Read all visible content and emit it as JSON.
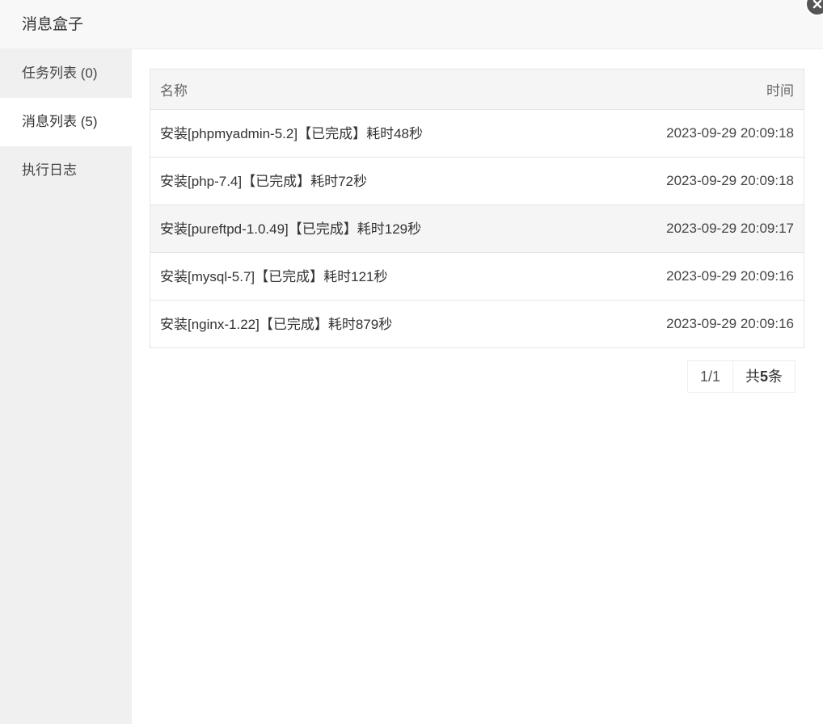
{
  "window": {
    "title": "消息盒子",
    "close_icon": "close-icon"
  },
  "sidebar": {
    "items": [
      {
        "label": "任务列表 (0)",
        "active": false
      },
      {
        "label": "消息列表 (5)",
        "active": true
      },
      {
        "label": "执行日志",
        "active": false
      }
    ]
  },
  "table": {
    "headers": {
      "name": "名称",
      "time": "时间"
    },
    "rows": [
      {
        "name": "安装[phpmyadmin-5.2]【已完成】耗时48秒",
        "time": "2023-09-29 20:09:18"
      },
      {
        "name": "安装[php-7.4]【已完成】耗时72秒",
        "time": "2023-09-29 20:09:18"
      },
      {
        "name": "安装[pureftpd-1.0.49]【已完成】耗时129秒",
        "time": "2023-09-29 20:09:17"
      },
      {
        "name": "安装[mysql-5.7]【已完成】耗时121秒",
        "time": "2023-09-29 20:09:16"
      },
      {
        "name": "安装[nginx-1.22]【已完成】耗时879秒",
        "time": "2023-09-29 20:09:16"
      }
    ]
  },
  "pager": {
    "page": "1/1",
    "total_prefix": "共",
    "total_count": "5",
    "total_suffix": "条"
  },
  "colors": {
    "sidebar_bg": "#f0f0f0",
    "header_bg": "#f8f8f8",
    "row_highlight": "#f5f5f5"
  }
}
